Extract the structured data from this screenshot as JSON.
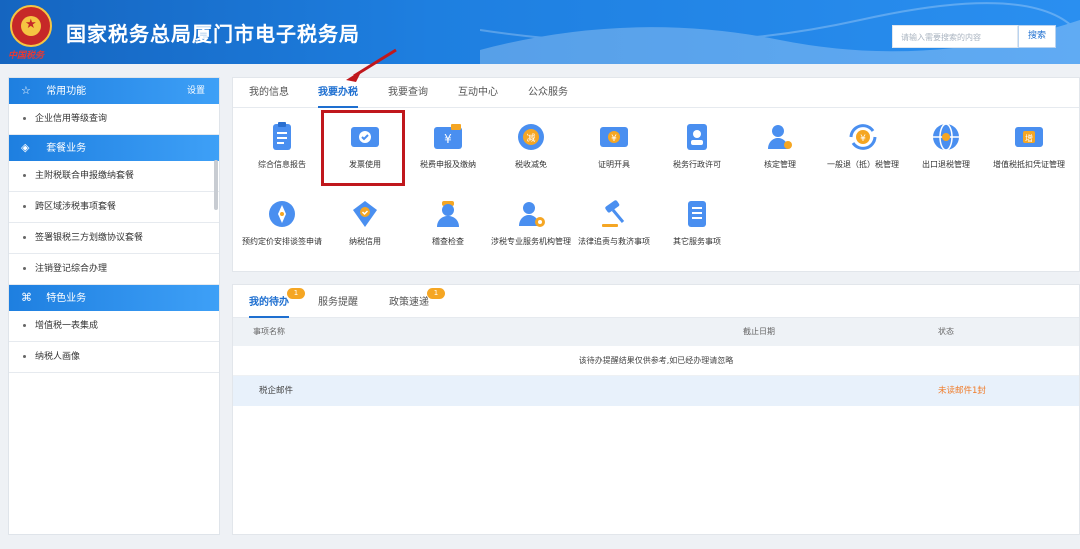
{
  "header": {
    "title": "国家税务总局厦门市电子税务局",
    "brand_sign": "中国税务",
    "search_placeholder": "请输入需要搜索的内容",
    "search_button": "搜索"
  },
  "sidebar": {
    "sections": [
      {
        "title": "常用功能",
        "action": "设置",
        "icon": "star-icon",
        "items": [
          "企业信用等级查询"
        ]
      },
      {
        "title": "套餐业务",
        "icon": "layers-icon",
        "items": [
          "主附税联合申报缴纳套餐",
          "跨区域涉税事项套餐",
          "签署银税三方划缴协议套餐",
          "注销登记综合办理"
        ]
      },
      {
        "title": "特色业务",
        "icon": "grid-icon",
        "items": [
          "增值税一表集成",
          "纳税人画像"
        ]
      }
    ]
  },
  "main_tabs": [
    "我的信息",
    "我要办税",
    "我要查询",
    "互动中心",
    "公众服务"
  ],
  "active_tab": "我要办税",
  "services": [
    {
      "label": "综合信息报告",
      "icon": "clipboard-icon"
    },
    {
      "label": "发票使用",
      "icon": "invoice-check-icon"
    },
    {
      "label": "税费申报及缴纳",
      "icon": "wallet-yuan-icon"
    },
    {
      "label": "税收减免",
      "icon": "reduction-coin-icon"
    },
    {
      "label": "证明开具",
      "icon": "certificate-yuan-icon"
    },
    {
      "label": "税务行政许可",
      "icon": "id-badge-icon"
    },
    {
      "label": "核定管理",
      "icon": "user-gear-icon"
    },
    {
      "label": "一般退（抵）税管理",
      "icon": "refund-cycle-icon"
    },
    {
      "label": "出口退税管理",
      "icon": "globe-icon"
    },
    {
      "label": "增值税抵扣凭证管理",
      "icon": "vat-ticket-icon"
    },
    {
      "label": "预约定价安排谈签申请",
      "icon": "compass-icon"
    },
    {
      "label": "纳税信用",
      "icon": "shield-check-icon"
    },
    {
      "label": "稽查检查",
      "icon": "inspector-icon"
    },
    {
      "label": "涉税专业服务机构管理",
      "icon": "agency-gear-icon"
    },
    {
      "label": "法律追责与救济事项",
      "icon": "gavel-icon"
    },
    {
      "label": "其它服务事项",
      "icon": "list-icon"
    }
  ],
  "todo": {
    "tabs": [
      {
        "label": "我的待办",
        "badge": "1"
      },
      {
        "label": "服务提醒",
        "badge": ""
      },
      {
        "label": "政策速递",
        "badge": "1"
      }
    ],
    "columns": [
      "事项名称",
      "截止日期",
      "状态"
    ],
    "note": "该待办提醒结果仅供参考,如已经办理请忽略",
    "rows": [
      {
        "name": "税企邮件",
        "deadline": "",
        "status": "未读邮件1封"
      }
    ]
  },
  "colors": {
    "primary": "#1e6fd0",
    "highlight": "#c0171c",
    "badge": "#f5a623",
    "status_warning": "#f07c2a"
  }
}
